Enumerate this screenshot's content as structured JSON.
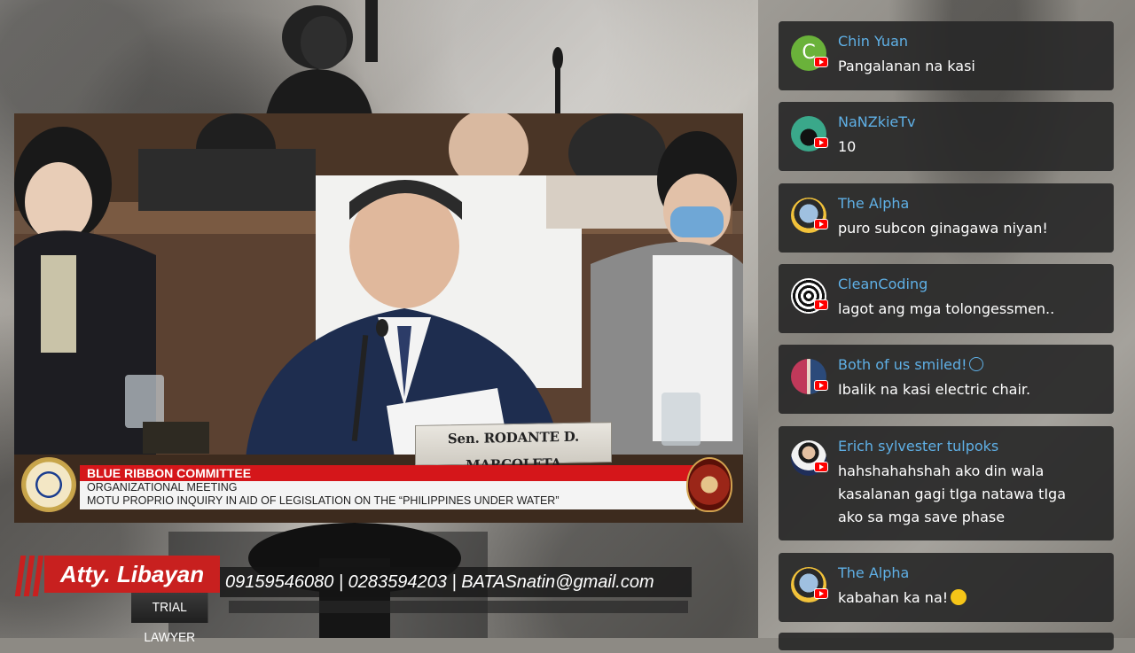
{
  "video": {
    "nameplate": "Sen. RODANTE D. MARCOLETA",
    "lower_third": {
      "title": "BLUE RIBBON COMMITTEE",
      "line1": "ORGANIZATIONAL MEETING",
      "line2": "MOTU PROPRIO INQUIRY IN AID OF LEGISLATION ON THE “PHILIPPINES UNDER WATER”"
    }
  },
  "banner": {
    "name": "Atty. Libayan",
    "role": "TRIAL LAWYER",
    "contact": "09159546080 | 0283594203 | BATASnatin@gmail.com"
  },
  "chat": {
    "messages": [
      {
        "author": "Chin Yuan",
        "text": "Pangalanan na kasi",
        "avatar": "letter-c-avatar",
        "avatar_color": "#6ab23a",
        "avatar_letter": "C"
      },
      {
        "author": "NaNZkieTv",
        "text": "10",
        "avatar": "motorbike-avatar"
      },
      {
        "author": "The Alpha",
        "text": "puro subcon ginagawa niyan!",
        "avatar": "cartoon-avatar"
      },
      {
        "author": "CleanCoding",
        "text": "lagot ang mga tolongessmen..",
        "avatar": "gear-pattern-avatar"
      },
      {
        "author": "Both of us smiled!",
        "text": "Ibalik na kasi electric chair.",
        "avatar": "couple-avatar",
        "author_emoji": "smile-emoji"
      },
      {
        "author": "Erich sylvester tulpoks",
        "text": "hahshahahshah ako din wala kasalanan gagi tIga natawa tIga ako sa mga save phase",
        "avatar": "person-avatar"
      },
      {
        "author": "The Alpha",
        "text": "kabahan ka na!",
        "avatar": "cartoon-avatar",
        "text_emoji": "laughing-emoji"
      }
    ]
  },
  "colors": {
    "accent_red": "#c8201f",
    "chat_author": "#5fb0e6",
    "chat_card": "#282828"
  }
}
